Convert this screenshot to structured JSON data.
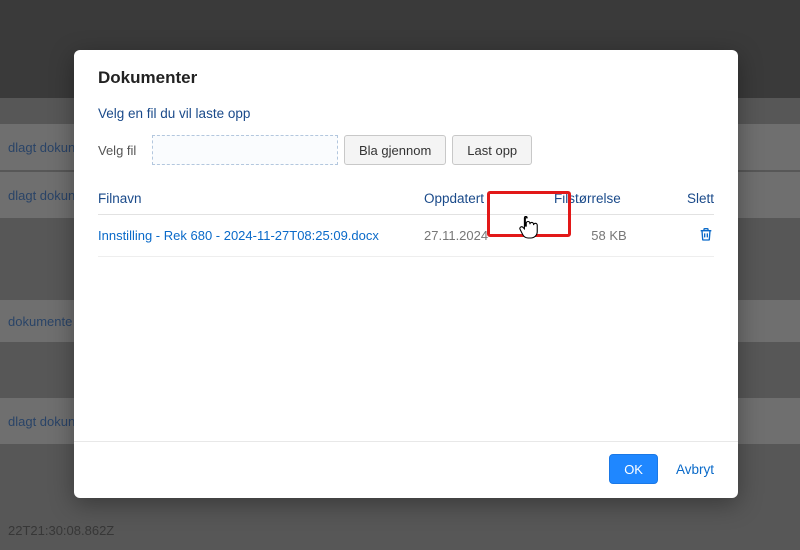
{
  "background": {
    "link1": "dlagt dokun",
    "link2": "dlagt dokun",
    "link3": "dokumente",
    "link4": "dlagt dokun",
    "timestamp": "22T21:30:08.862Z"
  },
  "modal": {
    "title": "Dokumenter",
    "hint": "Velg en fil du vil laste opp",
    "file_label": "Velg fil",
    "browse_label": "Bla gjennom",
    "upload_label": "Last opp",
    "columns": {
      "name": "Filnavn",
      "date": "Oppdatert",
      "size": "Filstørrelse",
      "delete": "Slett"
    },
    "rows": [
      {
        "name": "Innstilling - Rek 680 - 2024-11-27T08:25:09.docx",
        "date": "27.11.2024",
        "size": "58 KB"
      }
    ],
    "ok_label": "OK",
    "cancel_label": "Avbryt"
  }
}
